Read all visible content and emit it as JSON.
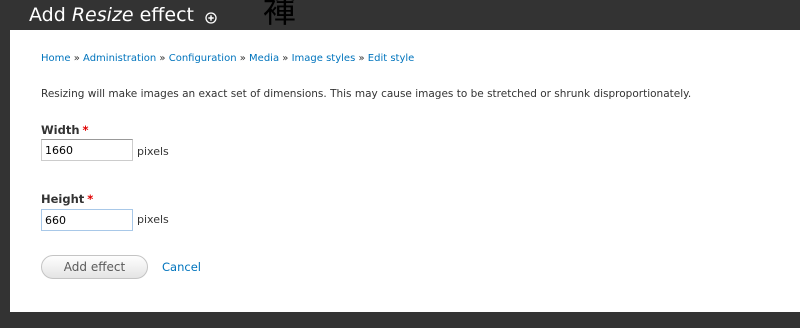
{
  "header": {
    "title_prefix": "Add ",
    "title_emphasis": "Resize",
    "title_suffix": " effect",
    "decorative_glyph": "褌",
    "shortcut_icon": "plus-circle-icon"
  },
  "breadcrumb": {
    "items": [
      "Home",
      "Administration",
      "Configuration",
      "Media",
      "Image styles",
      "Edit style"
    ],
    "separator": "»"
  },
  "description": "Resizing will make images an exact set of dimensions. This may cause images to be stretched or shrunk disproportionately.",
  "form": {
    "width": {
      "label": "Width",
      "required_mark": "*",
      "value": "1660",
      "suffix": "pixels"
    },
    "height": {
      "label": "Height",
      "required_mark": "*",
      "value": "660",
      "suffix": "pixels"
    },
    "submit_label": "Add effect",
    "cancel_label": "Cancel"
  },
  "colors": {
    "overlay_background": "#333333",
    "panel_background": "#ffffff",
    "link": "#0074bd",
    "required": "#e00000"
  }
}
